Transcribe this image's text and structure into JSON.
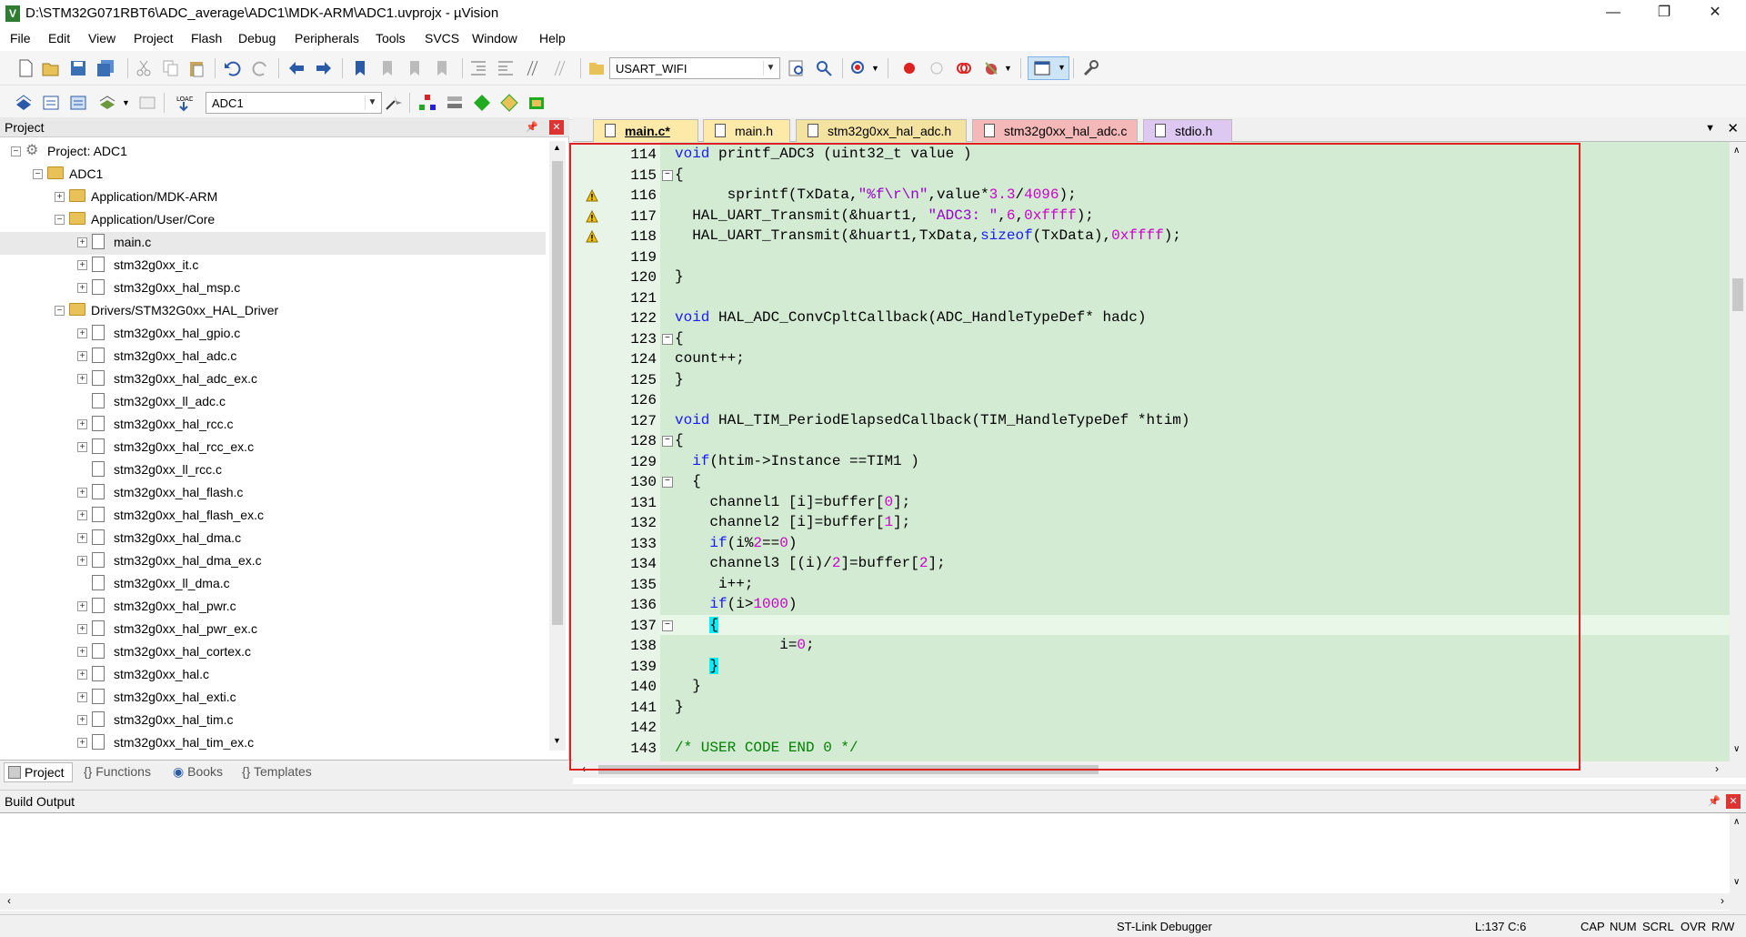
{
  "window": {
    "title": "D:\\STM32G071RBT6\\ADC_average\\ADC1\\MDK-ARM\\ADC1.uvprojx - µVision",
    "minimize": "—",
    "maximize": "❐",
    "close": "✕"
  },
  "menu": [
    "File",
    "Edit",
    "View",
    "Project",
    "Flash",
    "Debug",
    "Peripherals",
    "Tools",
    "SVCS",
    "Window",
    "Help"
  ],
  "toolbar1": {
    "combo_value": "USART_WIFI"
  },
  "toolbar2": {
    "target_value": "ADC1"
  },
  "project_pane": {
    "title": "Project",
    "tree": [
      {
        "label": "Project: ADC1",
        "level": 0,
        "kind": "project",
        "exp": "−"
      },
      {
        "label": "ADC1",
        "level": 1,
        "kind": "folder",
        "exp": "−"
      },
      {
        "label": "Application/MDK-ARM",
        "level": 2,
        "kind": "folder",
        "exp": "+"
      },
      {
        "label": "Application/User/Core",
        "level": 2,
        "kind": "folder",
        "exp": "−"
      },
      {
        "label": "main.c",
        "level": 3,
        "kind": "file",
        "exp": "+",
        "selected": true
      },
      {
        "label": "stm32g0xx_it.c",
        "level": 3,
        "kind": "file",
        "exp": "+"
      },
      {
        "label": "stm32g0xx_hal_msp.c",
        "level": 3,
        "kind": "file",
        "exp": "+"
      },
      {
        "label": "Drivers/STM32G0xx_HAL_Driver",
        "level": 2,
        "kind": "folder",
        "exp": "−"
      },
      {
        "label": "stm32g0xx_hal_gpio.c",
        "level": 3,
        "kind": "file",
        "exp": "+"
      },
      {
        "label": "stm32g0xx_hal_adc.c",
        "level": 3,
        "kind": "file",
        "exp": "+"
      },
      {
        "label": "stm32g0xx_hal_adc_ex.c",
        "level": 3,
        "kind": "file",
        "exp": "+"
      },
      {
        "label": "stm32g0xx_ll_adc.c",
        "level": 3,
        "kind": "file",
        "exp": ""
      },
      {
        "label": "stm32g0xx_hal_rcc.c",
        "level": 3,
        "kind": "file",
        "exp": "+"
      },
      {
        "label": "stm32g0xx_hal_rcc_ex.c",
        "level": 3,
        "kind": "file",
        "exp": "+"
      },
      {
        "label": "stm32g0xx_ll_rcc.c",
        "level": 3,
        "kind": "file",
        "exp": ""
      },
      {
        "label": "stm32g0xx_hal_flash.c",
        "level": 3,
        "kind": "file",
        "exp": "+"
      },
      {
        "label": "stm32g0xx_hal_flash_ex.c",
        "level": 3,
        "kind": "file",
        "exp": "+"
      },
      {
        "label": "stm32g0xx_hal_dma.c",
        "level": 3,
        "kind": "file",
        "exp": "+"
      },
      {
        "label": "stm32g0xx_hal_dma_ex.c",
        "level": 3,
        "kind": "file",
        "exp": "+"
      },
      {
        "label": "stm32g0xx_ll_dma.c",
        "level": 3,
        "kind": "file",
        "exp": ""
      },
      {
        "label": "stm32g0xx_hal_pwr.c",
        "level": 3,
        "kind": "file",
        "exp": "+"
      },
      {
        "label": "stm32g0xx_hal_pwr_ex.c",
        "level": 3,
        "kind": "file",
        "exp": "+"
      },
      {
        "label": "stm32g0xx_hal_cortex.c",
        "level": 3,
        "kind": "file",
        "exp": "+"
      },
      {
        "label": "stm32g0xx_hal.c",
        "level": 3,
        "kind": "file",
        "exp": "+"
      },
      {
        "label": "stm32g0xx_hal_exti.c",
        "level": 3,
        "kind": "file",
        "exp": "+"
      },
      {
        "label": "stm32g0xx_hal_tim.c",
        "level": 3,
        "kind": "file",
        "exp": "+"
      },
      {
        "label": "stm32g0xx_hal_tim_ex.c",
        "level": 3,
        "kind": "file",
        "exp": "+"
      }
    ],
    "bottom_tabs": [
      "Project",
      "Functions",
      "Books",
      "Templates"
    ]
  },
  "editor": {
    "tabs": [
      {
        "label": "main.c*",
        "color": "#fde9a8",
        "active": true
      },
      {
        "label": "main.h",
        "color": "#fde9a8"
      },
      {
        "label": "stm32g0xx_hal_adc.h",
        "color": "#f4e3a0"
      },
      {
        "label": "stm32g0xx_hal_adc.c",
        "color": "#f5b8b8"
      },
      {
        "label": "stdio.h",
        "color": "#dcc8f0"
      }
    ],
    "lines": [
      {
        "n": "114",
        "html": "<span class='kw'>void</span> printf_ADC3 (uint32_t value )"
      },
      {
        "n": "115",
        "html": "{",
        "fold": "−"
      },
      {
        "n": "116",
        "html": "      sprintf(TxData,<span class='str'>\"%f\\r\\n\"</span>,value*<span class='num'>3.3</span>/<span class='num'>4096</span>);",
        "warn": true
      },
      {
        "n": "117",
        "html": "  HAL_UART_Transmit(&amp;huart1, <span class='str'>\"ADC3: \"</span>,<span class='num'>6</span>,<span class='num'>0xffff</span>);",
        "warn": true
      },
      {
        "n": "118",
        "html": "  HAL_UART_Transmit(&amp;huart1,TxData,<span class='kw'>sizeof</span>(TxData),<span class='num'>0xffff</span>);",
        "warn": true
      },
      {
        "n": "119",
        "html": ""
      },
      {
        "n": "120",
        "html": "}"
      },
      {
        "n": "121",
        "html": ""
      },
      {
        "n": "122",
        "html": "<span class='kw'>void</span> HAL_ADC_ConvCpltCallback(ADC_HandleTypeDef* hadc)"
      },
      {
        "n": "123",
        "html": "{",
        "fold": "−"
      },
      {
        "n": "124",
        "html": "count++;"
      },
      {
        "n": "125",
        "html": "}"
      },
      {
        "n": "126",
        "html": ""
      },
      {
        "n": "127",
        "html": "<span class='kw'>void</span> HAL_TIM_PeriodElapsedCallback(TIM_HandleTypeDef *htim)"
      },
      {
        "n": "128",
        "html": "{",
        "fold": "−"
      },
      {
        "n": "129",
        "html": "  <span class='kw'>if</span>(htim-&gt;Instance ==TIM1 )"
      },
      {
        "n": "130",
        "html": "  {",
        "fold": "−"
      },
      {
        "n": "131",
        "html": "    channel1 [i]=buffer[<span class='num'>0</span>];"
      },
      {
        "n": "132",
        "html": "    channel2 [i]=buffer[<span class='num'>1</span>];"
      },
      {
        "n": "133",
        "html": "    <span class='kw'>if</span>(i%<span class='num'>2</span>==<span class='num'>0</span>)"
      },
      {
        "n": "134",
        "html": "    channel3 [(i)/<span class='num'>2</span>]=buffer[<span class='num'>2</span>];"
      },
      {
        "n": "135",
        "html": "     i++;"
      },
      {
        "n": "136",
        "html": "    <span class='kw'>if</span>(i&gt;<span class='num'>1000</span>)"
      },
      {
        "n": "137",
        "html": "    <span class='brk'>{</span>",
        "fold": "−",
        "current": true
      },
      {
        "n": "138",
        "html": "            i=<span class='num'>0</span>;"
      },
      {
        "n": "139",
        "html": "    <span class='brk'>}</span>"
      },
      {
        "n": "140",
        "html": "  }"
      },
      {
        "n": "141",
        "html": "}"
      },
      {
        "n": "142",
        "html": ""
      },
      {
        "n": "143",
        "html": "<span class='cm'>/* USER CODE END 0 */</span>"
      }
    ]
  },
  "build_output": {
    "title": "Build Output"
  },
  "status": {
    "debugger": "ST-Link Debugger",
    "position": "L:137 C:6",
    "cap": "CAP",
    "num": "NUM",
    "scrl": "SCRL",
    "ovr": "OVR",
    "rw": "R/W"
  }
}
